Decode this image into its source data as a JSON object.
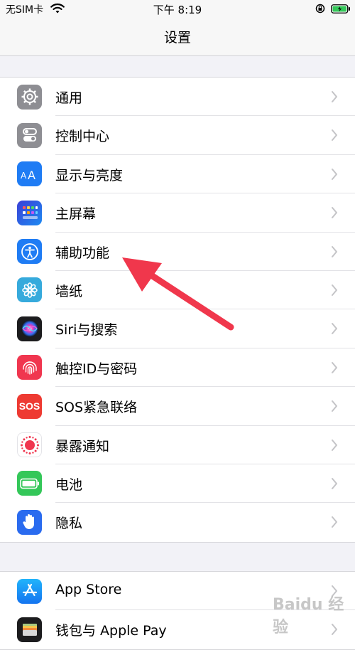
{
  "status_bar": {
    "carrier": "无SIM卡",
    "time": "下午 8:19"
  },
  "nav": {
    "title": "设置"
  },
  "group1": [
    {
      "label": "通用",
      "icon": "gear-icon",
      "color": "#8e8e93"
    },
    {
      "label": "控制中心",
      "icon": "toggles-icon",
      "color": "#8e8e93"
    },
    {
      "label": "显示与亮度",
      "icon": "text-size-icon",
      "color": "#1f7cf4"
    },
    {
      "label": "主屏幕",
      "icon": "app-grid-icon",
      "color": "#2f56d9"
    },
    {
      "label": "辅助功能",
      "icon": "accessibility-icon",
      "color": "#1f7cf4"
    },
    {
      "label": "墙纸",
      "icon": "flower-icon",
      "color": "#36aadc"
    },
    {
      "label": "Siri与搜索",
      "icon": "siri-icon",
      "color": "#222222"
    },
    {
      "label": "触控ID与密码",
      "icon": "fingerprint-icon",
      "color": "#f0364f"
    },
    {
      "label": "SOS紧急联络",
      "icon": "sos-icon",
      "color": "#ee3a32",
      "icon_text": "SOS"
    },
    {
      "label": "暴露通知",
      "icon": "exposure-icon",
      "color": "#ffffff"
    },
    {
      "label": "电池",
      "icon": "battery-icon",
      "color": "#34c759"
    },
    {
      "label": "隐私",
      "icon": "hand-icon",
      "color": "#2a6bef"
    }
  ],
  "group2": [
    {
      "label": "App Store",
      "icon": "app-store-icon",
      "color": "#1b8cf6"
    },
    {
      "label": "钱包与 Apple Pay",
      "icon": "wallet-icon",
      "color": "#1c1c1e"
    }
  ],
  "annotation": {
    "arrow_color": "#f0374c"
  },
  "watermark": "Baidu 经验"
}
